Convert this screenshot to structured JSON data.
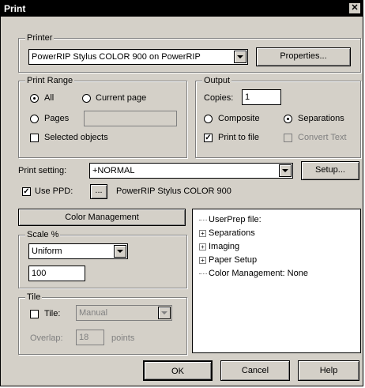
{
  "window": {
    "title": "Print",
    "close_glyph": "✕"
  },
  "printer": {
    "group_label": "Printer",
    "selected": "PowerRIP Stylus COLOR 900 on PowerRIP",
    "properties_label": "Properties..."
  },
  "print_range": {
    "group_label": "Print Range",
    "all_label": "All",
    "current_page_label": "Current page",
    "pages_label": "Pages",
    "pages_value": "",
    "selected_objects_label": "Selected objects",
    "selected": "All"
  },
  "output": {
    "group_label": "Output",
    "copies_label": "Copies:",
    "copies_value": "1",
    "composite_label": "Composite",
    "separations_label": "Separations",
    "selected": "Separations",
    "print_to_file_label": "Print to file",
    "print_to_file_checked": true,
    "convert_text_label": "Convert Text",
    "convert_text_checked": false
  },
  "print_setting": {
    "label": "Print setting:",
    "value": "+NORMAL",
    "setup_label": "Setup..."
  },
  "ppd": {
    "label": "Use PPD:",
    "checked": true,
    "browse_label": "...",
    "name": "PowerRIP Stylus COLOR 900"
  },
  "color_management_label": "Color Management",
  "scale": {
    "group_label": "Scale %",
    "mode": "Uniform",
    "value": "100"
  },
  "tile": {
    "group_label": "Tile",
    "tile_label": "Tile:",
    "tile_checked": false,
    "tile_mode": "Manual",
    "overlap_label": "Overlap:",
    "overlap_value": "18",
    "points_label": "points"
  },
  "tree": [
    {
      "label": "UserPrep file:",
      "expandable": false
    },
    {
      "label": "Separations",
      "expandable": true
    },
    {
      "label": "Imaging",
      "expandable": true
    },
    {
      "label": "Paper Setup",
      "expandable": true
    },
    {
      "label": "Color Management: None",
      "expandable": false
    }
  ],
  "buttons": {
    "ok": "OK",
    "cancel": "Cancel",
    "help": "Help"
  }
}
